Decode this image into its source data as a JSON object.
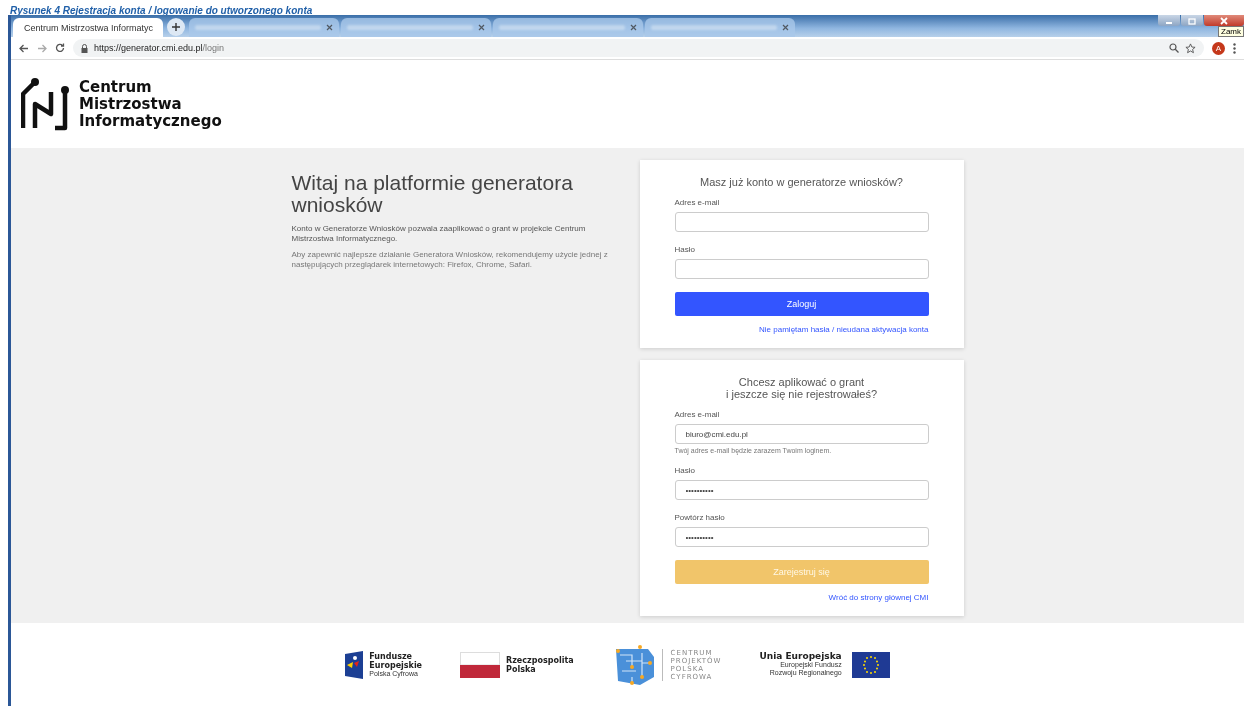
{
  "document_caption": "Rysunek 4 Rejestracja konta / logowanie do utworzonego konta",
  "browser": {
    "tabs": [
      {
        "label": "Centrum Mistrzostwa Informatyc",
        "selected": true
      },
      {
        "selected": false
      },
      {
        "selected": false
      },
      {
        "selected": false
      },
      {
        "selected": false
      }
    ],
    "url_host": "https://generator.cmi.edu.pl",
    "url_path": "/login",
    "profile_initial": "A",
    "tooltip": "Zamk"
  },
  "header": {
    "logo_lines": [
      "Centrum",
      "Mistrzostwa",
      "Informatycznego"
    ]
  },
  "intro": {
    "title": "Witaj na platformie generatora wniosków",
    "paragraphs": [
      "Konto w Generatorze Wniosków pozwala zaaplikować o grant w projekcie Centrum Mistrzostwa Informatycznego.",
      "Aby zapewnić najlepsze działanie Generatora Wniosków, rekomendujemy użycie jednej z następujących przeglądarek internetowych: Firefox, Chrome, Safari."
    ]
  },
  "login": {
    "title": "Masz już konto w generatorze wniosków?",
    "fields": [
      {
        "label": "Adres e-mail"
      },
      {
        "label": "Hasło"
      }
    ],
    "button": "Zaloguj",
    "link": "Nie pamiętam hasła / nieudana aktywacja konta"
  },
  "register": {
    "title_lines": [
      "Chcesz aplikować o grant",
      "i jeszcze się nie rejestrowałeś?"
    ],
    "fields": [
      {
        "label": "Adres e-mail",
        "value": "biuro@cmi.edu.pl",
        "hint": "Twój adres e-mail będzie zarazem Twoim loginem."
      },
      {
        "label": "Hasło",
        "value": "••••••••••"
      },
      {
        "label": "Powtórz hasło",
        "value": "••••••••••"
      }
    ],
    "button": "Zarejestruj się",
    "button_disabled": true,
    "link": "Wróć do strony głównej CMI"
  },
  "footer": {
    "logos": [
      {
        "kind": "fe",
        "lines": [
          "Fundusze",
          "Europejskie"
        ],
        "sub": "Polska Cyfrowa"
      },
      {
        "kind": "rp",
        "lines": [
          "Rzeczpospolita",
          "Polska"
        ]
      },
      {
        "kind": "cppc",
        "lines": [
          "CENTRUM",
          "PROJEKTÓW",
          "POLSKA",
          "CYFROWA"
        ]
      },
      {
        "kind": "ue",
        "lines": [
          "Unia Europejska"
        ],
        "sub": "Europejski Fundusz Rozwoju Regionalnego"
      }
    ]
  }
}
